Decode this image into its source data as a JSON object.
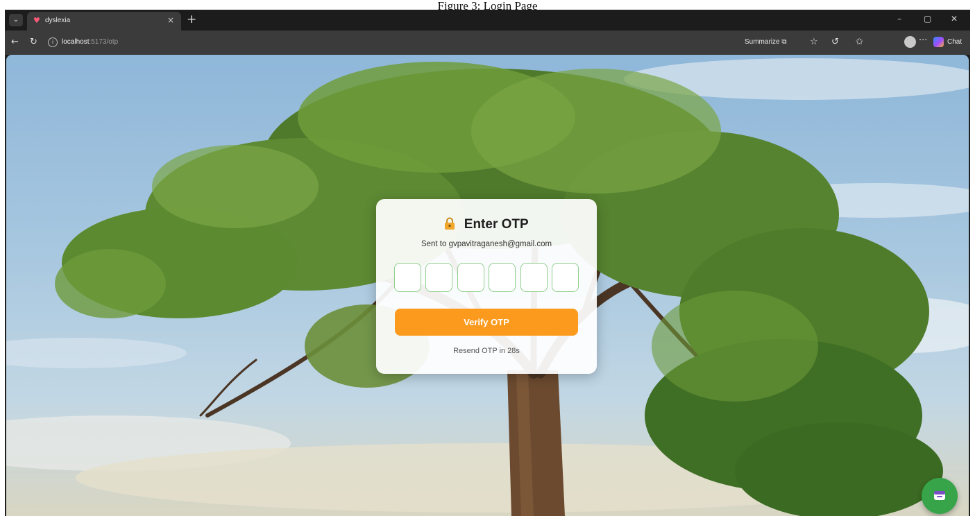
{
  "figure_caption": "Figure 3: Login Page",
  "browser": {
    "tab_title": "dyslexia",
    "tab_close": "×",
    "new_tab": "+",
    "tab_menu": "⌄",
    "window": {
      "minimize": "–",
      "restore": "▢",
      "close": "✕"
    },
    "url_host": "localhost",
    "url_path": ":5173/otp",
    "summarize_label": "Summarize",
    "more_label": "···",
    "chat_label": "Chat"
  },
  "otp_card": {
    "title": "Enter OTP",
    "subtitle": "Sent to gvpavitraganesh@gmail.com",
    "digit_count": 6,
    "verify_label": "Verify OTP",
    "resend_text": "Resend OTP in 28s"
  },
  "colors": {
    "accent": "#fb9a1c",
    "input_border": "#8fcf8c",
    "fab": "#37a44a"
  },
  "icons": {
    "lock": "lock-icon",
    "fab": "chat-widget-icon"
  }
}
